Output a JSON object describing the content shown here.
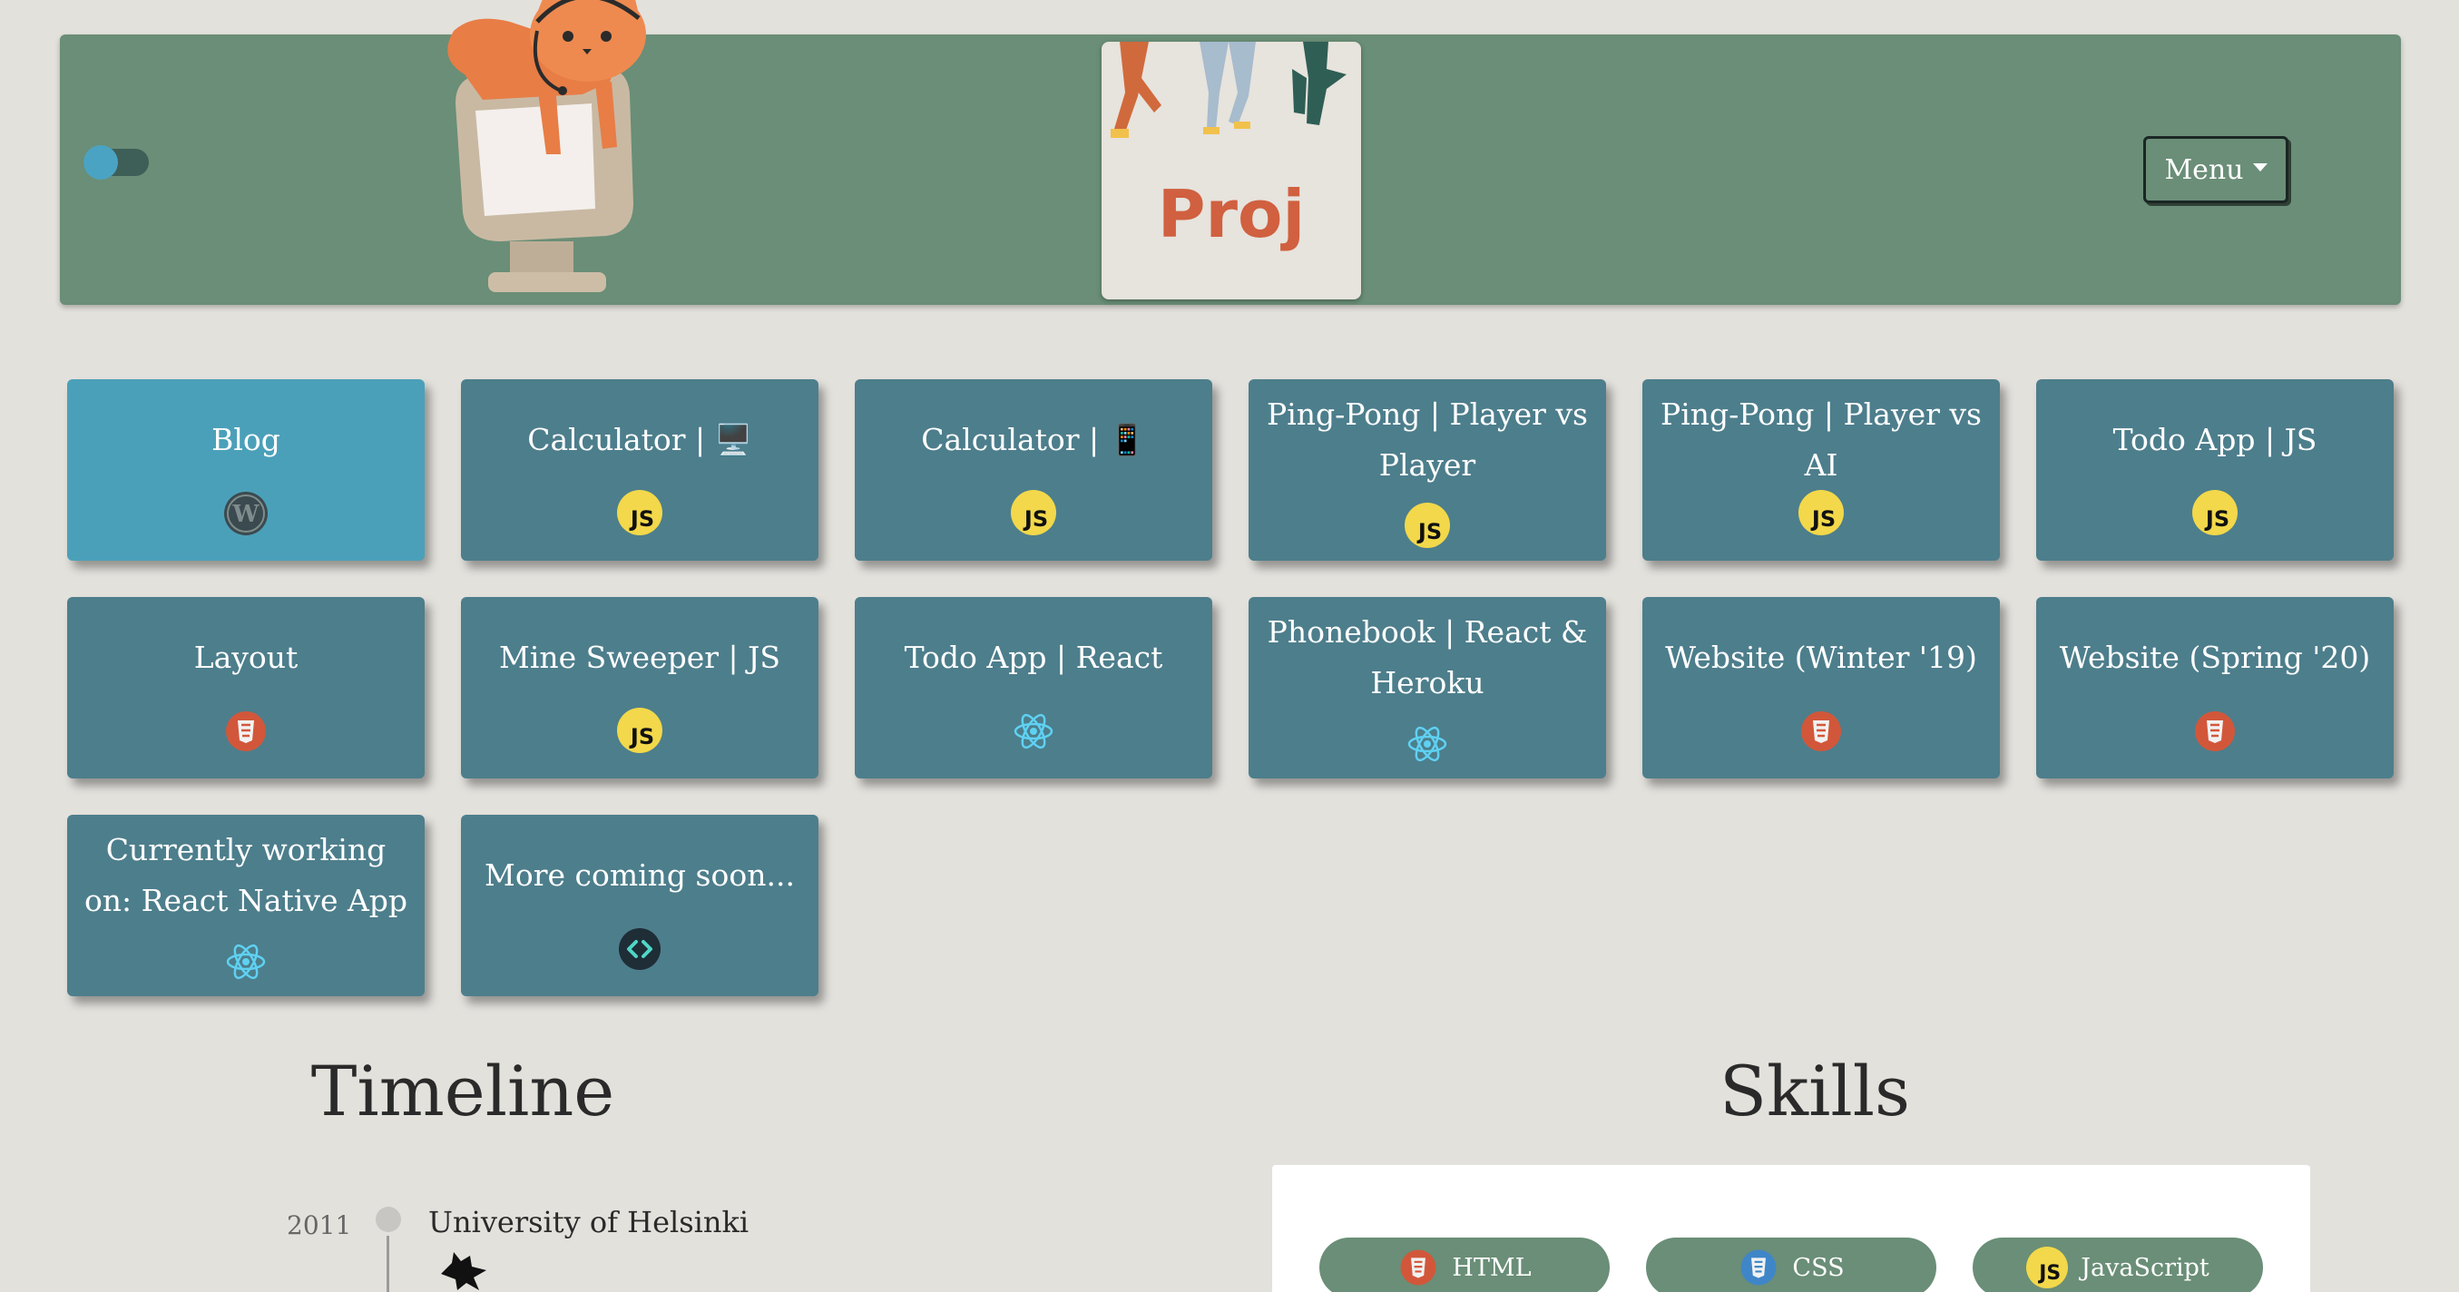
{
  "header": {
    "menu_label": "Menu",
    "logo_text": "Proj"
  },
  "projects": [
    {
      "title": "Blog",
      "icon": "wordpress-icon"
    },
    {
      "title": "Calculator | 🖥️",
      "icon": "javascript-icon"
    },
    {
      "title": "Calculator | 📱",
      "icon": "javascript-icon"
    },
    {
      "title": "Ping-Pong | Player vs Player",
      "icon": "javascript-icon"
    },
    {
      "title": "Ping-Pong | Player vs AI",
      "icon": "javascript-icon"
    },
    {
      "title": "Todo App | JS",
      "icon": "javascript-icon"
    },
    {
      "title": "Layout",
      "icon": "html5-icon"
    },
    {
      "title": "Mine Sweeper | JS",
      "icon": "javascript-icon"
    },
    {
      "title": "Todo App | React",
      "icon": "react-icon"
    },
    {
      "title": "Phonebook | React & Heroku",
      "icon": "react-icon"
    },
    {
      "title": "Website (Winter '19)",
      "icon": "html5-icon"
    },
    {
      "title": "Website (Spring '20)",
      "icon": "html5-icon"
    },
    {
      "title": "Currently working on: React Native App",
      "icon": "react-icon"
    },
    {
      "title": "More coming soon...",
      "icon": "code-icon"
    }
  ],
  "timeline": {
    "title": "Timeline",
    "entries": [
      {
        "year": "2011",
        "label": "University of Helsinki"
      }
    ]
  },
  "skills": {
    "title": "Skills",
    "items": [
      {
        "label": "HTML",
        "icon": "html5-icon"
      },
      {
        "label": "CSS",
        "icon": "css3-icon"
      },
      {
        "label": "JavaScript",
        "icon": "javascript-icon"
      }
    ]
  },
  "js_glyph": "JS",
  "colors": {
    "header_bg": "#6a8e77",
    "card_bg": "#4d7e8c",
    "card_featured_bg": "#4ba0b9",
    "page_bg": "#e3e1dc",
    "toggle_knob": "#4ba3c3"
  }
}
